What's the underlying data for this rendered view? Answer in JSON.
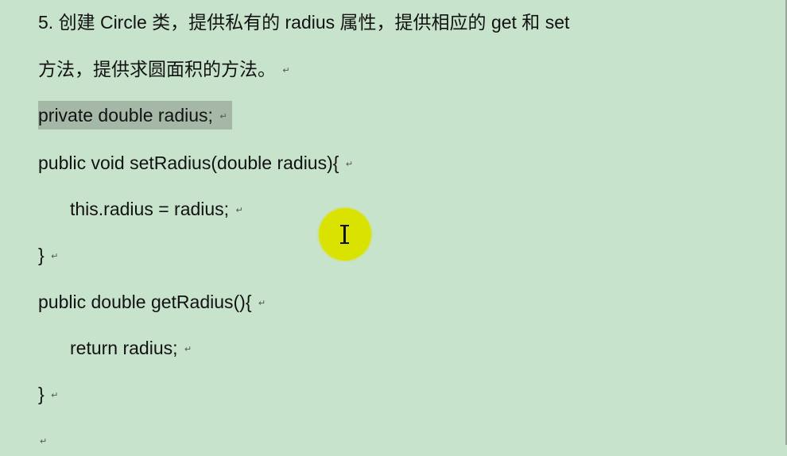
{
  "document": {
    "heading_line_1": "5. 创建 Circle 类，提供私有的 radius 属性，提供相应的 get 和 set",
    "heading_line_2": "方法，提供求圆面积的方法。",
    "code_lines": [
      "private double radius;",
      "public void setRadius(double radius){",
      "this.radius = radius;",
      "}",
      "public double getRadius(){",
      "return radius;",
      "}"
    ],
    "paragraph_mark": "↵"
  },
  "cursor": {
    "icon": "i-beam-cursor-icon",
    "highlight_color": "#d9e200"
  },
  "colors": {
    "page_background": "#c7e3cc",
    "selection": "#a5b8a8",
    "text": "#121212"
  }
}
